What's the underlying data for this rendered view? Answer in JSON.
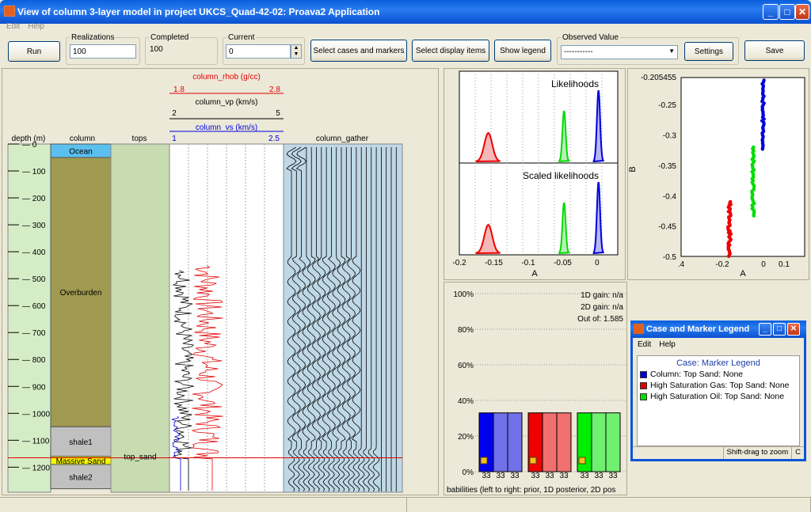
{
  "window": {
    "title": "View of column 3-layer model in project UKCS_Quad-42-02: Proava2 Application"
  },
  "menu": [
    "Edit",
    "Help"
  ],
  "toolbar": {
    "run_label": "Run",
    "realizations_label": "Realizations",
    "realizations_value": "100",
    "completed_label": "Completed",
    "completed_value": "100",
    "current_label": "Current",
    "current_value": "0",
    "select_cases_label": "Select cases and markers",
    "select_display_label": "Select display items",
    "show_legend_label": "Show legend",
    "observed_label": "Observed Value",
    "observed_value": "-----------",
    "settings_label": "Settings",
    "save_label": "Save"
  },
  "log_panel": {
    "depth_header": "depth (m)",
    "column_header": "column",
    "tops_header": "tops",
    "gather_header": "column_gather",
    "rhob_label": "column_rhob (g/cc)",
    "rhob_min": "1.8",
    "rhob_max": "2.8",
    "vp_label": "column_vp (km/s)",
    "vp_min": "2",
    "vp_max": "5",
    "vs_label": "column_vs (km/s)",
    "vs_min": "1",
    "vs_max": "2.5",
    "depth_ticks": [
      "0",
      "100",
      "200",
      "300",
      "400",
      "500",
      "600",
      "700",
      "800",
      "900",
      "1000",
      "1100",
      "1200"
    ],
    "layers": [
      {
        "name": "Ocean",
        "top": 0,
        "bottom": 50,
        "color": "#5bc0ee"
      },
      {
        "name": "Overburden",
        "top": 50,
        "bottom": 1050,
        "color": "#a09a50"
      },
      {
        "name": "shale1",
        "top": 1050,
        "bottom": 1160,
        "color": "#c0c0c0"
      },
      {
        "name": "Massive Sand",
        "top": 1160,
        "bottom": 1190,
        "color": "#f8f800"
      },
      {
        "name": "shale2",
        "top": 1190,
        "bottom": 1280,
        "color": "#c0c0c0"
      }
    ],
    "top_marker": "top_sand",
    "top_marker_depth": 1165
  },
  "likelihood_panel": {
    "title1": "Likelihoods",
    "title2": "Scaled likelihoods",
    "xlabel": "A",
    "xticks": [
      "-0.2",
      "-0.15",
      "-0.1",
      "-0.05",
      "0"
    ]
  },
  "scatter_panel": {
    "ymax_label": "-0.205455",
    "yticks": [
      "-0.25",
      "-0.3",
      "-0.35",
      "-0.4",
      "-0.45",
      "-0.5"
    ],
    "xticks": [
      ".4",
      "-0.2",
      "0",
      "0.1"
    ],
    "xlabel": "A",
    "ylabel": "B"
  },
  "prob_panel": {
    "gain1d": "1D gain: n/a",
    "gain2d": "2D gain: n/a",
    "outof": "Out of: 1.585",
    "yticks": [
      "100%",
      "80%",
      "60%",
      "40%",
      "20%",
      "0%"
    ],
    "footer": "babilities (left to right: prior, 1D posterior, 2D pos",
    "groups": [
      {
        "color": "#0000ee",
        "light": "#7070e8",
        "values": [
          33,
          33,
          33
        ]
      },
      {
        "color": "#ee0000",
        "light": "#f07070",
        "values": [
          33,
          33,
          33
        ]
      },
      {
        "color": "#00ee00",
        "light": "#70f070",
        "values": [
          33,
          33,
          33
        ]
      }
    ],
    "bar_labels": [
      "33",
      "33",
      "33",
      "33",
      "33",
      "33",
      "33",
      "33",
      "33"
    ]
  },
  "legend_window": {
    "title": "Case and Marker Legend",
    "menu": [
      "Edit",
      "Help"
    ],
    "heading": "Case: Marker Legend",
    "entries": [
      {
        "label": "Column: Top Sand: None",
        "color": "#0000dd"
      },
      {
        "label": "High Saturation Gas: Top Sand: None",
        "color": "#dd0000"
      },
      {
        "label": "High Saturation Oil: Top Sand: None",
        "color": "#00dd00"
      }
    ],
    "status": "Shift-drag to zoom",
    "status2": "C"
  }
}
